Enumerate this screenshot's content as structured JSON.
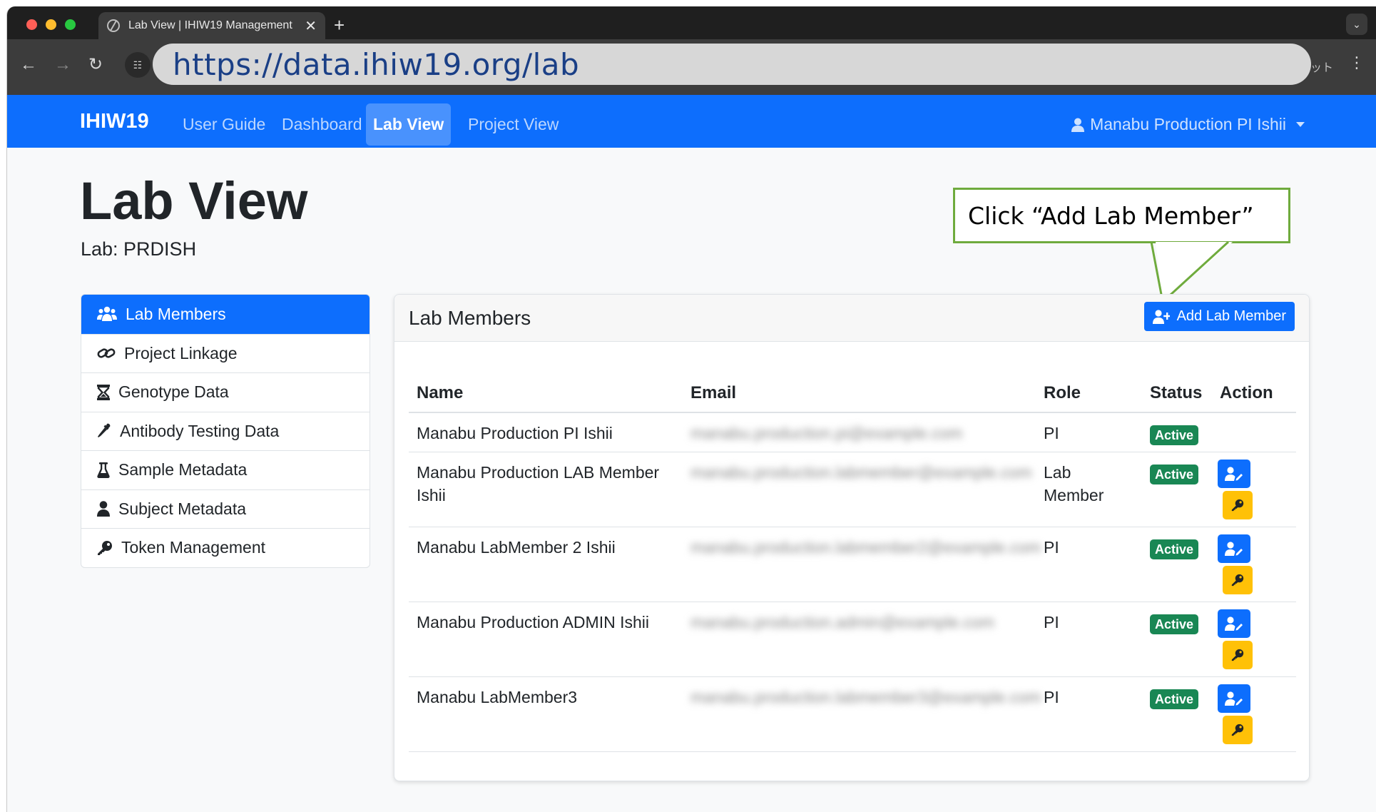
{
  "browser": {
    "tab_title": "Lab View | IHIW19 Management",
    "tab_close": "✕",
    "new_tab": "+",
    "url": "https://data.ihiw19.org/lab",
    "toolbar_extra": "ット"
  },
  "navbar": {
    "brand": "IHIW19",
    "links": {
      "user_guide": "User Guide",
      "dashboard": "Dashboard",
      "lab_view": "Lab View",
      "project_view": "Project View"
    },
    "user": "Manabu Production PI Ishii"
  },
  "page": {
    "title": "Lab View",
    "lab_label": "Lab: PRDISH"
  },
  "callout": {
    "text": "Click “Add Lab Member”"
  },
  "sidebar": {
    "items": [
      {
        "label": "Lab Members",
        "icon": "users-icon",
        "active": true
      },
      {
        "label": "Project Linkage",
        "icon": "link-icon"
      },
      {
        "label": "Genotype Data",
        "icon": "hourglass-icon"
      },
      {
        "label": "Antibody Testing Data",
        "icon": "eyedropper-icon"
      },
      {
        "label": "Sample Metadata",
        "icon": "flask-icon"
      },
      {
        "label": "Subject Metadata",
        "icon": "user-icon"
      },
      {
        "label": "Token Management",
        "icon": "key-icon"
      }
    ]
  },
  "card": {
    "title": "Lab Members",
    "add_button": "Add Lab Member"
  },
  "table": {
    "headers": {
      "name": "Name",
      "email": "Email",
      "role": "Role",
      "status": "Status",
      "action": "Action"
    },
    "rows": [
      {
        "name": "Manabu Production PI Ishii",
        "email": "manabu.production.pi@example.com",
        "role": "PI",
        "status": "Active"
      },
      {
        "name": "Manabu Production LAB Member Ishii",
        "email": "manabu.production.labmember@example.com",
        "role": "Lab Member",
        "status": "Active"
      },
      {
        "name": "Manabu LabMember 2 Ishii",
        "email": "manabu.production.labmember2@example.com",
        "role": "PI",
        "status": "Active"
      },
      {
        "name": "Manabu Production ADMIN Ishii",
        "email": "manabu.production.admin@example.com",
        "role": "PI",
        "status": "Active"
      },
      {
        "name": "Manabu LabMember3",
        "email": "manabu.production.labmember3@example.com",
        "role": "PI",
        "status": "Active"
      }
    ]
  },
  "colors": {
    "primary": "#0d6efd",
    "success": "#198754",
    "warning": "#ffc107",
    "callout_border": "#6fab3d"
  }
}
